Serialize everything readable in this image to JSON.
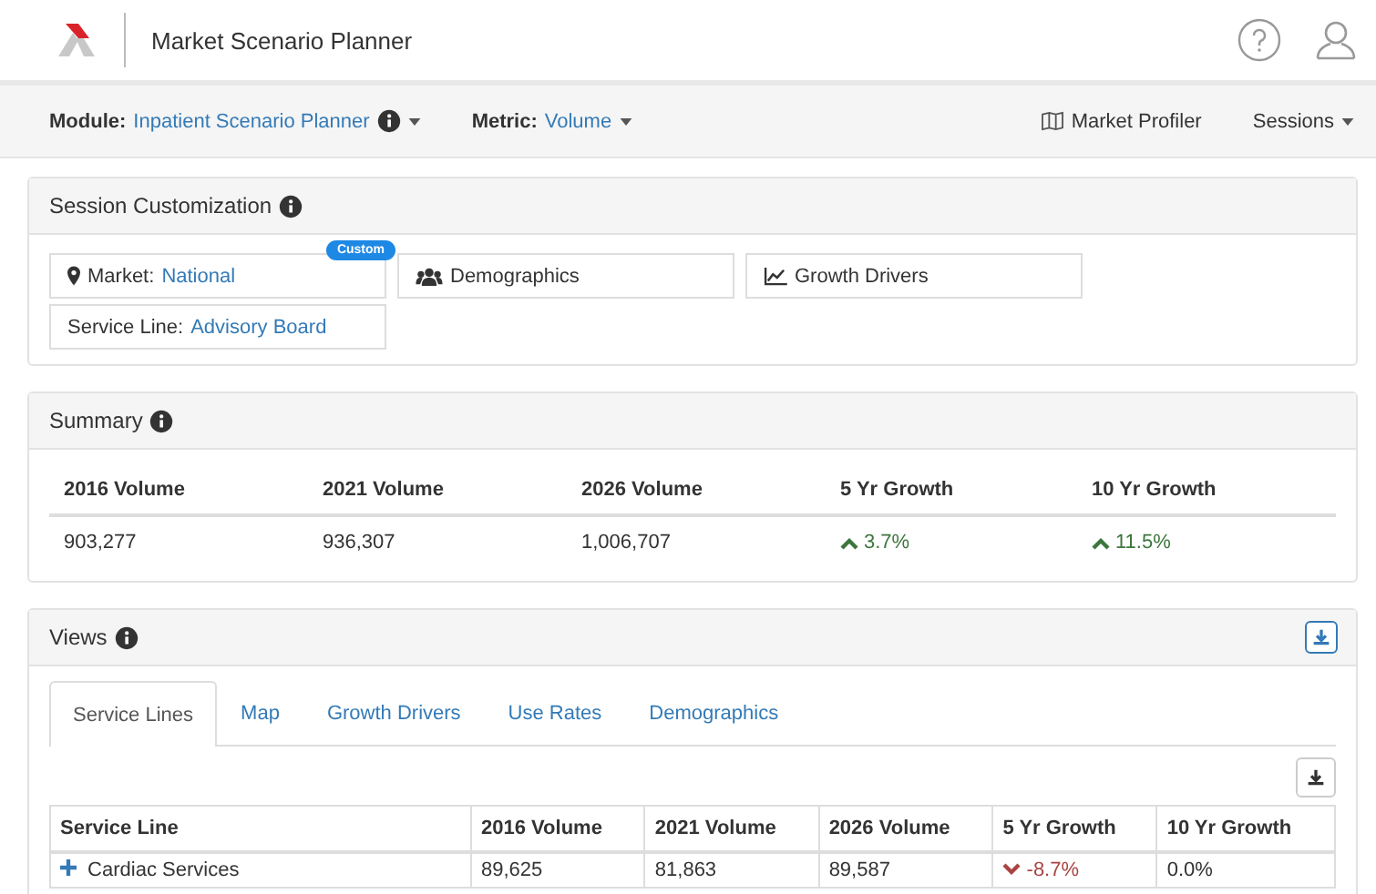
{
  "header": {
    "title": "Market Scenario Planner"
  },
  "navbar": {
    "module_label": "Module:",
    "module_value": "Inpatient Scenario Planner",
    "metric_label": "Metric:",
    "metric_value": "Volume",
    "links": [
      {
        "label": "Market Profiler",
        "kind": "map"
      },
      {
        "label": "Sessions",
        "kind": "dropdown"
      }
    ]
  },
  "session": {
    "title": "Session Customization",
    "items": [
      {
        "kind": "market",
        "label": "Market:",
        "value": "National",
        "badge": "Custom"
      },
      {
        "kind": "demographics",
        "label": "Demographics"
      },
      {
        "kind": "growth",
        "label": "Growth Drivers"
      },
      {
        "kind": "service",
        "label": "Service Line:",
        "value": "Advisory Board"
      }
    ]
  },
  "summary": {
    "title": "Summary",
    "columns": [
      "2016 Volume",
      "2021 Volume",
      "2026 Volume",
      "5 Yr Growth",
      "10 Yr Growth"
    ],
    "values": [
      {
        "text": "903,277",
        "kind": "plain"
      },
      {
        "text": "936,307",
        "kind": "plain"
      },
      {
        "text": "1,006,707",
        "kind": "plain"
      },
      {
        "text": "3.7%",
        "kind": "up"
      },
      {
        "text": "11.5%",
        "kind": "up"
      }
    ]
  },
  "views": {
    "title": "Views",
    "tabs": [
      {
        "label": "Service Lines",
        "selected": true
      },
      {
        "label": "Map",
        "selected": false
      },
      {
        "label": "Growth Drivers",
        "selected": false
      },
      {
        "label": "Use Rates",
        "selected": false
      },
      {
        "label": "Demographics",
        "selected": false
      }
    ],
    "table": {
      "columns": [
        "Service Line",
        "2016 Volume",
        "2021 Volume",
        "2026 Volume",
        "5 Yr Growth",
        "10 Yr Growth"
      ],
      "rows": [
        {
          "cells": [
            {
              "text": "Cardiac Services",
              "kind": "plain"
            },
            {
              "text": "89,625",
              "kind": "plain"
            },
            {
              "text": "81,863",
              "kind": "plain"
            },
            {
              "text": "89,587",
              "kind": "plain"
            },
            {
              "text": "-8.7%",
              "kind": "down"
            },
            {
              "text": "0.0%",
              "kind": "plain"
            }
          ],
          "expandable": true
        }
      ]
    }
  }
}
